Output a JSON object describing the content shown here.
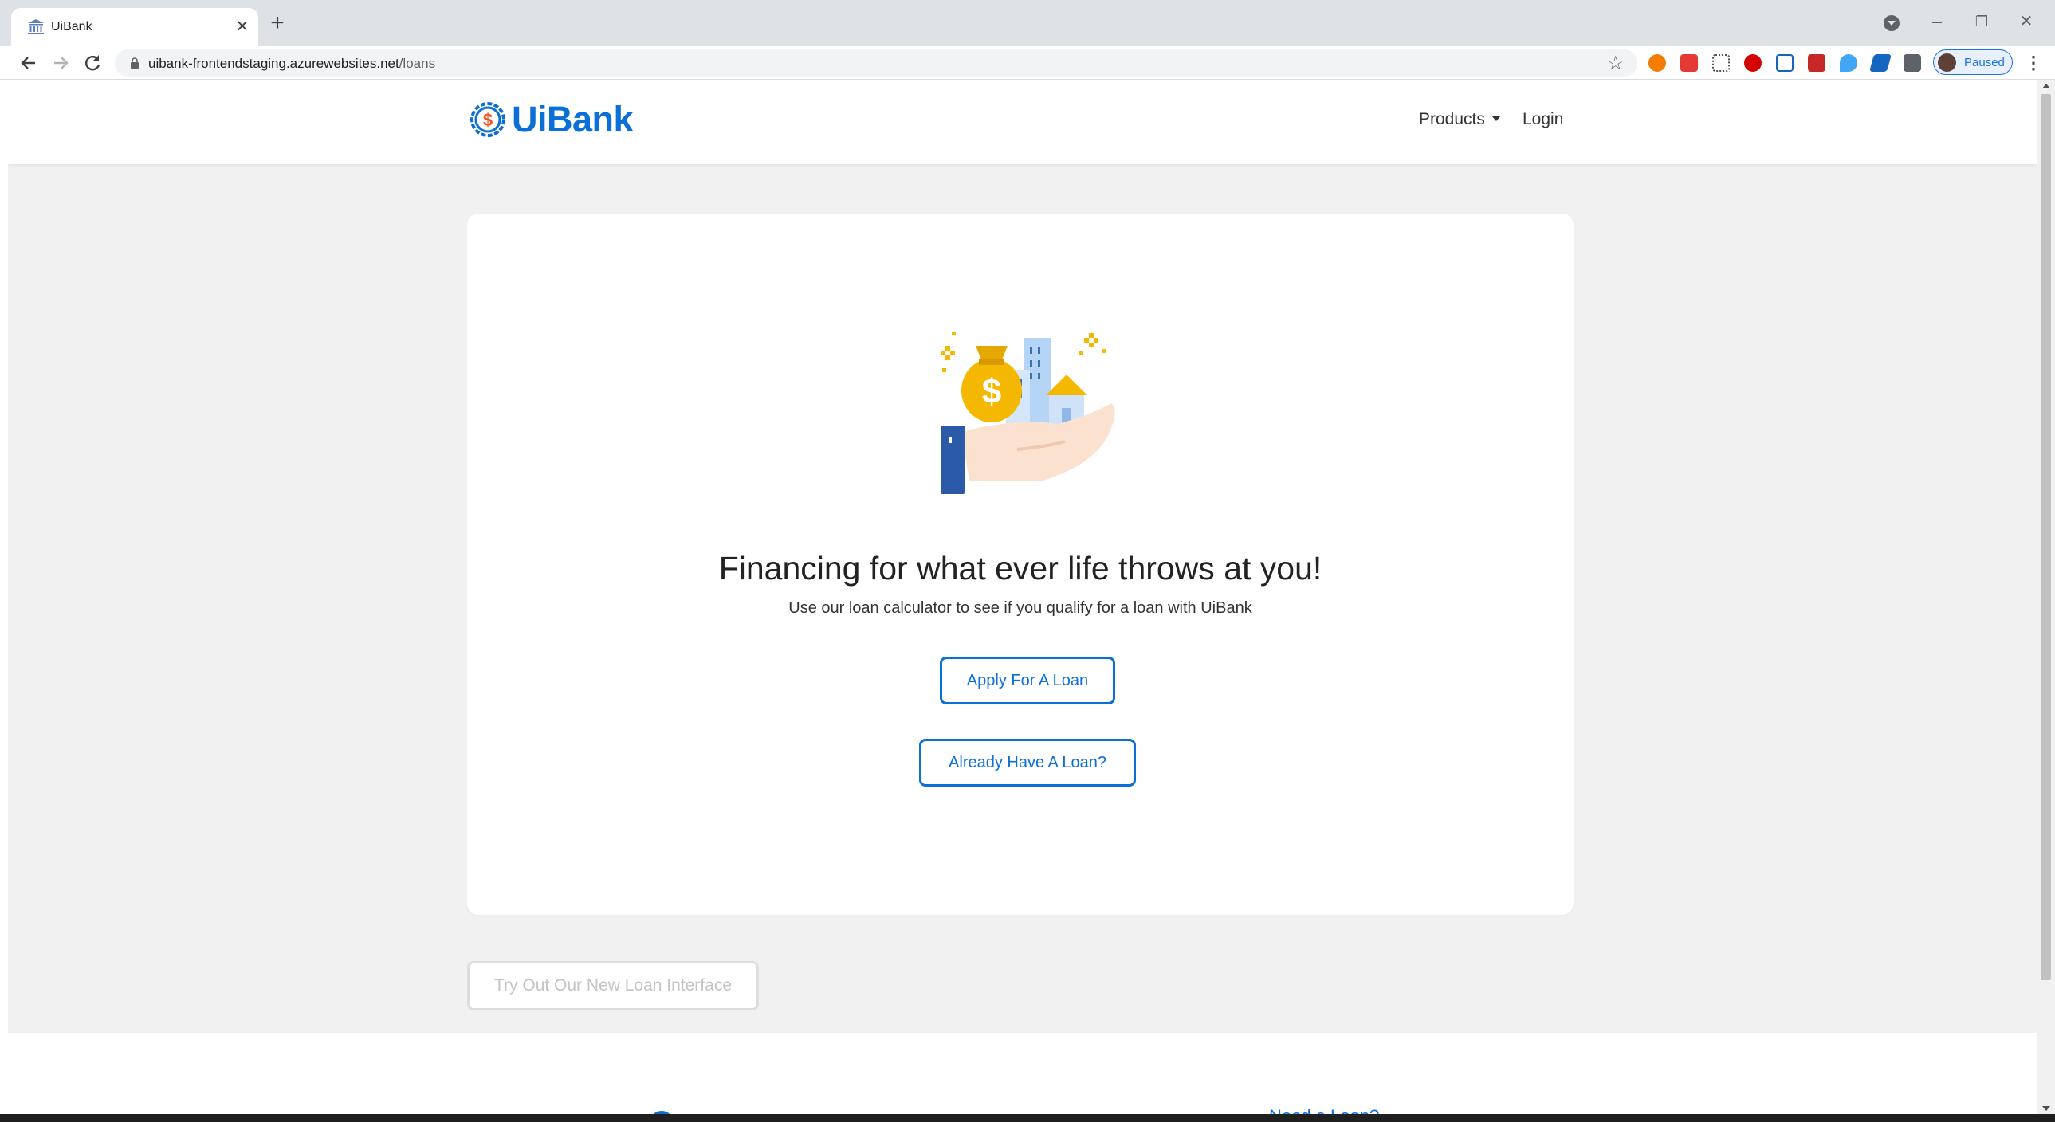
{
  "browser": {
    "tab_title": "UiBank",
    "tab_close": "×",
    "new_tab": "+",
    "url_host": "uibank-frontendstaging.azurewebsites.net",
    "url_path": "/loans",
    "profile_status": "Paused",
    "bookmark_icon": "star-icon",
    "extensions": [
      "ext-orange",
      "ext-pocket",
      "ext-grid",
      "ext-shield",
      "ext-uipath",
      "ext-red",
      "ext-drop",
      "ext-arrow",
      "ext-puzzle"
    ],
    "window_controls": {
      "minimize": "–",
      "restore": "❐",
      "close": "✕"
    }
  },
  "navbar": {
    "brand": "UiBank",
    "products_label": "Products",
    "login_label": "Login"
  },
  "hero": {
    "headline": "Financing for what ever life throws at you!",
    "subline": "Use our loan calculator to see if you qualify for a loan with UiBank",
    "apply_label": "Apply For A Loan",
    "already_label": "Already Have A Loan?"
  },
  "secondary": {
    "try_label": "Try Out Our New Loan Interface"
  },
  "footer": {
    "partial_link": "Need a Loan?"
  },
  "colors": {
    "brand_blue": "#0a6fd6",
    "logo_orange": "#f4511e",
    "page_bg": "#f1f1f1"
  }
}
